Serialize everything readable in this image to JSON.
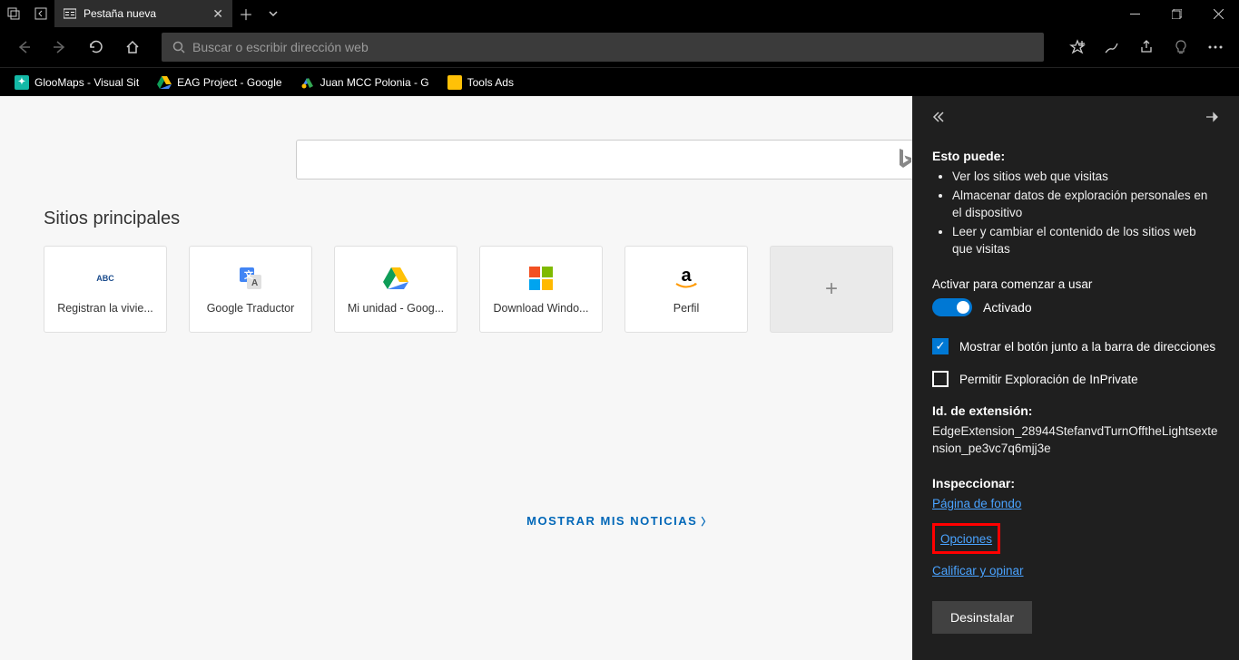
{
  "titlebar": {
    "tab_title": "Pestaña nueva"
  },
  "urlbar": {
    "placeholder": "Buscar o escribir dirección web"
  },
  "bookmarks": [
    {
      "label": "GlooMaps - Visual Sit",
      "color": "#14b8a6"
    },
    {
      "label": "EAG Project - Google",
      "color": "#ffc107"
    },
    {
      "label": "Juan MCC Polonia - G",
      "color": "#0078d4"
    },
    {
      "label": "Tools Ads",
      "color": "#ffc107"
    }
  ],
  "ntp": {
    "section": "Sitios principales",
    "news": "MOSTRAR MIS NOTICIAS",
    "tiles": [
      {
        "label": "Registran la vivie...",
        "icon": "abc"
      },
      {
        "label": "Google Traductor",
        "icon": "translate"
      },
      {
        "label": "Mi unidad - Goog...",
        "icon": "drive"
      },
      {
        "label": "Download Windo...",
        "icon": "windows"
      },
      {
        "label": "Perfil",
        "icon": "amazon"
      }
    ]
  },
  "panel": {
    "can_title": "Esto puede:",
    "can": [
      "Ver los sitios web que visitas",
      "Almacenar datos de exploración personales en el dispositivo",
      "Leer y cambiar el contenido de los sitios web que visitas"
    ],
    "activate_label": "Activar para comenzar a usar",
    "toggle_state": "Activado",
    "show_button": "Mostrar el botón junto a la barra de direcciones",
    "inprivate": "Permitir Exploración de InPrivate",
    "extid_label": "Id. de extensión:",
    "extid": "EdgeExtension_28944StefanvdTurnOfftheLightsextension_pe3vc7q6mjj3e",
    "inspect_label": "Inspeccionar:",
    "bg_page": "Página de fondo",
    "options": "Opciones",
    "rate": "Calificar y opinar",
    "uninstall": "Desinstalar"
  }
}
